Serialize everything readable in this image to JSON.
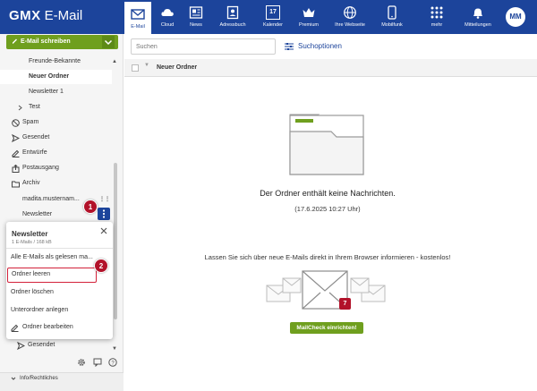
{
  "app": {
    "brand": "GMX",
    "name": "E-Mail"
  },
  "nav": {
    "items": [
      "E-Mail",
      "Cloud",
      "News",
      "Adressbuch",
      "Kalender",
      "Premium",
      "Ihre Webseite",
      "Mobilfunk",
      "mehr",
      "Mitteilungen"
    ],
    "calendar_day": "17",
    "avatar_initials": "MM"
  },
  "sidebar": {
    "compose_label": "E-Mail schreiben",
    "folders": {
      "freunde": "Freunde-Bekannte",
      "neuer_ordner": "Neuer Ordner",
      "newsletter1": "Newsletter 1",
      "test": "Test",
      "spam": "Spam",
      "gesendet": "Gesendet",
      "entwuerfe": "Entwürfe",
      "postausgang": "Postausgang",
      "archiv": "Archiv",
      "account": "madita.musternam...",
      "newsletter": "Newsletter",
      "gesendet2": "Gesendet"
    },
    "info_label": "Info/Rechtliches"
  },
  "context_menu": {
    "title": "Newsletter",
    "subtitle": "1 E-Mails / 168 kB",
    "items": {
      "mark_read": "Alle E-Mails als gelesen ma...",
      "empty": "Ordner leeren",
      "delete": "Ordner löschen",
      "subfolder": "Unterordner anlegen",
      "edit": "Ordner bearbeiten"
    }
  },
  "callouts": {
    "first": "1",
    "second": "2"
  },
  "main": {
    "search_placeholder": "Suchen",
    "search_options": "Suchoptionen",
    "folder_name": "Neuer Ordner",
    "empty_message": "Der Ordner enthält keine Nachrichten.",
    "date": "(17.6.2025 10:27 Uhr)",
    "promo": "Lassen Sie sich über neue E-Mails direkt in Ihrem Browser informieren - kostenlos!",
    "promo_badge": "7",
    "cta": "MailCheck einrichten!"
  },
  "colors": {
    "brand_blue": "#1c449b",
    "accent_green": "#6f9f1e",
    "callout_red": "#b2122a"
  }
}
